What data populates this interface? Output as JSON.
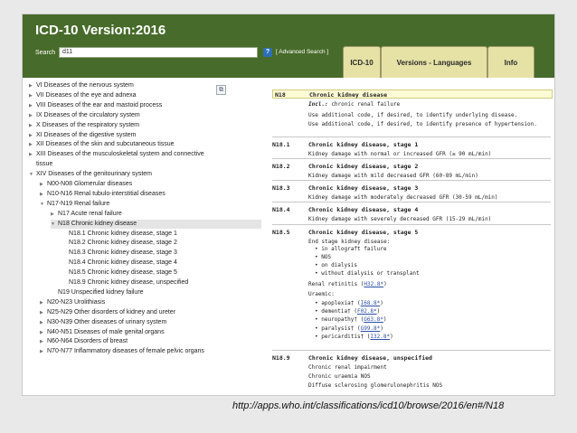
{
  "header": {
    "title": "ICD-10 Version:2016",
    "search_label": "Search",
    "search_value": "d11",
    "help_label": "?",
    "advanced_search": "[ Advanced Search ]",
    "tabs": [
      "ICD-10",
      "Versions - Languages",
      "Info"
    ]
  },
  "tree": [
    {
      "label": "VI Diseases of the nervous system",
      "state": "collapsed",
      "indent": 0
    },
    {
      "label": "VII Diseases of the eye and adnexa",
      "state": "collapsed",
      "indent": 0
    },
    {
      "label": "VIII Diseases of the ear and mastoid process",
      "state": "collapsed",
      "indent": 0
    },
    {
      "label": "IX Diseases of the circulatory system",
      "state": "collapsed",
      "indent": 0
    },
    {
      "label": "X Diseases of the respiratory system",
      "state": "collapsed",
      "indent": 0
    },
    {
      "label": "XI Diseases of the digestive system",
      "state": "collapsed",
      "indent": 0
    },
    {
      "label": "XII Diseases of the skin and subcutaneous tissue",
      "state": "collapsed",
      "indent": 0
    },
    {
      "label": "XIII Diseases of the musculoskeletal system and connective",
      "state": "collapsed",
      "indent": 0
    },
    {
      "label": "tissue",
      "state": "none",
      "indent": 0
    },
    {
      "label": "XIV Diseases of the genitourinary system",
      "state": "expanded",
      "indent": 0
    },
    {
      "label": "N00-N08 Glomerular diseases",
      "state": "collapsed",
      "indent": 1
    },
    {
      "label": "N10-N16 Renal tubulo-interstitial diseases",
      "state": "collapsed",
      "indent": 1
    },
    {
      "label": "N17-N19 Renal failure",
      "state": "expanded",
      "indent": 1
    },
    {
      "label": "N17 Acute renal failure",
      "state": "collapsed",
      "indent": 2
    },
    {
      "label": "N18 Chronic kidney disease",
      "state": "expanded",
      "indent": 2,
      "selected": true
    },
    {
      "label": "N18.1 Chronic kidney disease, stage 1",
      "state": "none",
      "indent": 3
    },
    {
      "label": "N18.2 Chronic kidney disease, stage 2",
      "state": "none",
      "indent": 3
    },
    {
      "label": "N18.3 Chronic kidney disease, stage 3",
      "state": "none",
      "indent": 3
    },
    {
      "label": "N18.4 Chronic kidney disease, stage 4",
      "state": "none",
      "indent": 3
    },
    {
      "label": "N18.5 Chronic kidney disease, stage 5",
      "state": "none",
      "indent": 3
    },
    {
      "label": "N18.9 Chronic kidney disease, unspecified",
      "state": "none",
      "indent": 3
    },
    {
      "label": "N19 Unspecified kidney failure",
      "state": "none",
      "indent": 2
    },
    {
      "label": "N20-N23 Urolithiasis",
      "state": "collapsed",
      "indent": 1
    },
    {
      "label": "N25-N29 Other disorders of kidney and ureter",
      "state": "collapsed",
      "indent": 1
    },
    {
      "label": "N30-N39 Other diseases of urinary system",
      "state": "collapsed",
      "indent": 1
    },
    {
      "label": "N40-N51 Diseases of male genital organs",
      "state": "collapsed",
      "indent": 1
    },
    {
      "label": "N60-N64 Disorders of breast",
      "state": "collapsed",
      "indent": 1
    },
    {
      "label": "N70-N77 Inflammatory diseases of female pelvic organs",
      "state": "collapsed",
      "indent": 1
    }
  ],
  "detail": {
    "main_code": "N18",
    "main_title": "Chronic kidney disease",
    "incl_label": "Incl.:",
    "incl_text": "chronic renal failure",
    "notes": [
      "Use additional code, if desired, to identify underlying disease.",
      "Use additional code, if desired, to identify presence of hypertension."
    ],
    "stages": [
      {
        "code": "N18.1",
        "title": "Chronic kidney disease, stage 1",
        "desc": "Kidney damage with normal or increased GFR (≥ 90 mL/min)"
      },
      {
        "code": "N18.2",
        "title": "Chronic kidney disease, stage 2",
        "desc": "Kidney damage with mild decreased GFR (60-89 mL/min)"
      },
      {
        "code": "N18.3",
        "title": "Chronic kidney disease, stage 3",
        "desc": "Kidney damage with moderately decreased GFR (30-59 mL/min)"
      },
      {
        "code": "N18.4",
        "title": "Chronic kidney disease, stage 4",
        "desc": "Kidney damage with severely decreased GFR (15-29 mL/min)"
      },
      {
        "code": "N18.5",
        "title": "Chronic kidney disease, stage 5",
        "desc": "End stage kidney disease:"
      }
    ],
    "stage5_bullets": [
      "in allograft failure",
      "NOS",
      "on dialysis",
      "without dialysis or transplant"
    ],
    "renal_retinitis": "Renal retinitis (",
    "renal_retinitis_link": "H32.8*",
    "uraemic_label": "Uraemic:",
    "uraemic_items": [
      {
        "text": "apoplexia† (",
        "link": "I68.8*"
      },
      {
        "text": "dementia† (",
        "link": "F02.8*"
      },
      {
        "text": "neuropathy† (",
        "link": "G63.8*"
      },
      {
        "text": "paralysis† (",
        "link": "G99.8*"
      },
      {
        "text": "pericarditis† (",
        "link": "I32.8*"
      }
    ],
    "unspecified": {
      "code": "N18.9",
      "title": "Chronic kidney disease, unspecified",
      "lines": [
        "Chronic renal impairment",
        "Chronic uraemia NOS",
        "Diffuse sclerosing glomerulonephritis NOS"
      ]
    }
  },
  "caption": "http://apps.who.int/classifications/icd10/browse/2016/en#/N18"
}
